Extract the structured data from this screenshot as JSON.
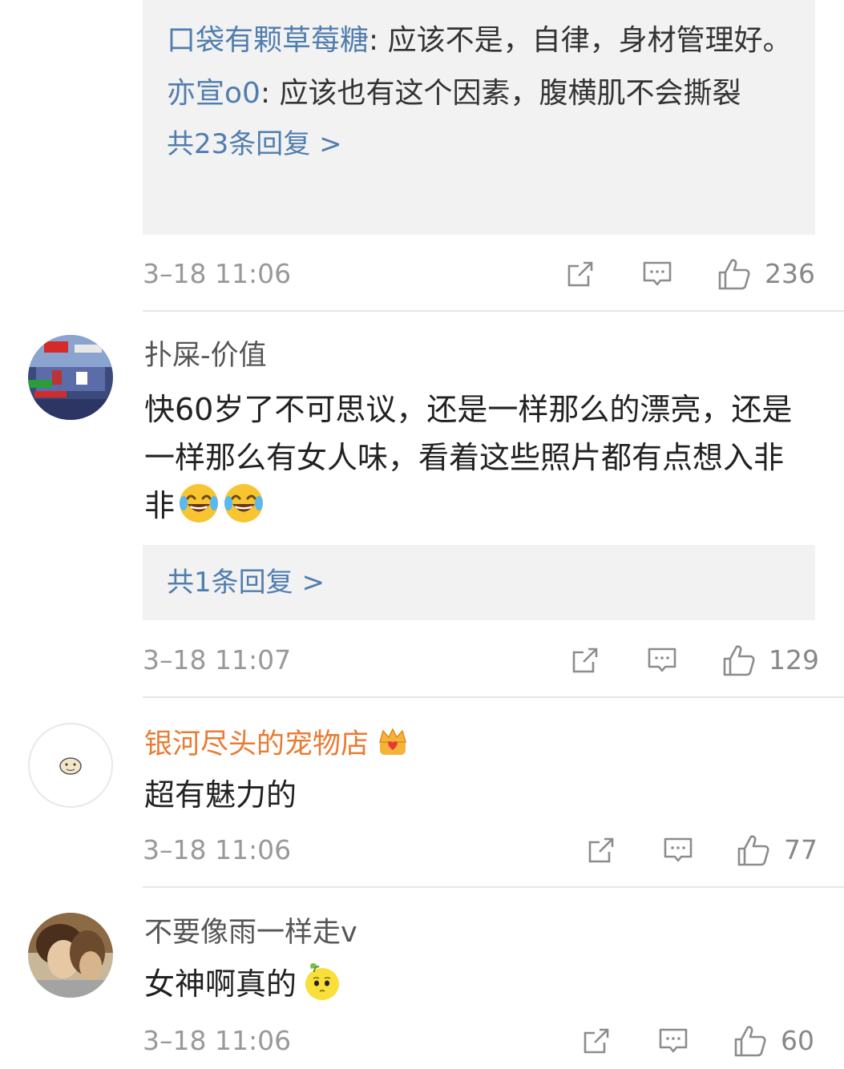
{
  "colors": {
    "link_blue": "#507daf",
    "vip_orange": "#ea7b32",
    "meta_gray": "#999999",
    "reply_bg": "#f2f2f2"
  },
  "first_comment": {
    "replies": [
      {
        "user": "口袋有颗草莓糖",
        "text": ": 应该不是，自律，身材管理好。"
      },
      {
        "user": "亦宣o0",
        "text": ": 应该也有这个因素，腹横肌不会撕裂"
      }
    ],
    "more_replies": "共23条回复 >",
    "time": "3–18 11:06",
    "likes": "236"
  },
  "comments": [
    {
      "user": "扑屎-价值",
      "text": "快60岁了不可思议，还是一样那么的漂亮，还是一样那么有女人味，看着这些照片都有点想入非非",
      "emojis": [
        "laugh-cry-emoji",
        "laugh-cry-emoji"
      ],
      "more_replies": "共1条回复 >",
      "time": "3–18 11:07",
      "likes": "129"
    },
    {
      "user": "银河尽头的宠物店",
      "badge": "crown-badge-icon",
      "text": "超有魅力的",
      "time": "3–18 11:06",
      "likes": "77"
    },
    {
      "user": "不要像雨一样走v",
      "text": "女神啊真的",
      "emojis": [
        "lemon-emoji"
      ],
      "time": "3–18 11:06",
      "likes": "60"
    }
  ],
  "icons": {
    "share": "share-icon",
    "comment": "comment-icon",
    "like": "like-icon"
  }
}
